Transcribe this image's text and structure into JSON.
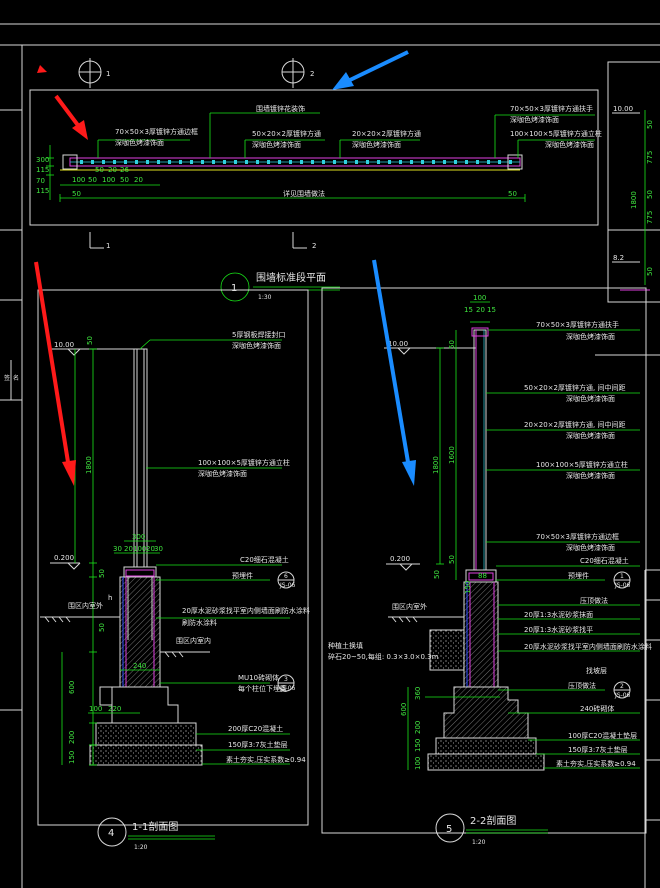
{
  "plan": {
    "title_num": "1",
    "title": "围墙标准段平面",
    "scale": "1:30",
    "section_marks": [
      "1",
      "2"
    ],
    "callouts": [
      "70×50×3厚镀锌方通边框",
      "深咖色烤漆饰面",
      "50×20×2厚镀锌方通",
      "深咖色烤漆饰面",
      "20×20×2厚镀锌方通",
      "深咖色烤漆饰面",
      "70×50×3厚镀锌方通扶手",
      "深咖色烤漆饰面",
      "100×100×5厚镀锌方通立柱",
      "深咖色烤漆饰面",
      "围墙镀锌花装饰",
      "详见围墙做法"
    ],
    "dims": [
      "300",
      "115",
      "70",
      "115",
      "100",
      "50",
      "100",
      "50",
      "20",
      "50",
      "20",
      "26",
      "20",
      "300"
    ]
  },
  "section1": {
    "title_num": "4",
    "title": "1-1剖面图",
    "scale": "1:20",
    "levels": [
      "10.00",
      "0.200"
    ],
    "dims": [
      "1800",
      "50",
      "50",
      "600",
      "200",
      "150",
      "100",
      "300",
      "30",
      "20",
      "100",
      "20",
      "30",
      "240",
      "100",
      "220"
    ],
    "callouts": [
      "5厚钢板焊接封口",
      "深咖色烤漆饰面",
      "100×100×5厚镀锌方通立柱",
      "深咖色烤漆饰面",
      "C20细石混凝土",
      "预埋件",
      "20厚水泥砂浆找平室内侧墙面刷防水涂料",
      "刷防水涂料",
      "MU10砖砌体",
      "每个柱位下埋置",
      "200厚C20混凝土",
      "150厚3:7灰土垫层",
      "素土夯实,压实系数≥0.94"
    ],
    "labels": [
      "围区内室外",
      "围区内室内",
      "h"
    ],
    "ref_circles": [
      "6",
      "3"
    ],
    "ref_sub": [
      "JS-06",
      "JS-06"
    ]
  },
  "section2": {
    "title_num": "5",
    "title": "2-2剖面图",
    "scale": "1:20",
    "levels": [
      "10.00",
      "0.200"
    ],
    "dims": [
      "1800",
      "50",
      "50",
      "1600",
      "50",
      "600",
      "360",
      "200",
      "150",
      "100",
      "15",
      "20",
      "15",
      "150",
      "88"
    ],
    "callouts": [
      "70×50×3厚镀锌方通扶手",
      "深咖色烤漆饰面",
      "50×20×2厚镀锌方通, 间中间距",
      "深咖色烤漆饰面",
      "20×20×2厚镀锌方通, 间中间距",
      "深咖色烤漆饰面",
      "100×100×5厚镀锌方通立柱",
      "深咖色烤漆饰面",
      "70×50×3厚镀锌方通边框",
      "深咖色烤漆饰面",
      "C20细石混凝土",
      "预埋件",
      "压顶做法",
      "20厚1:3水泥砂浆抹面",
      "20厚1:3水泥砂浆找平",
      "20厚水泥砂浆找平室内侧墙面刷防水涂料",
      "找坡层",
      "压顶做法",
      "240砖砌体",
      "100厚C20混凝土垫层",
      "150厚3:7灰土垫层",
      "素土夯实,压实系数≥0.94"
    ],
    "labels": [
      "围区内室外",
      "种植土换填",
      "碎石20~50,每组: 0.3×3.0×0.3m"
    ],
    "ref_circles": [
      "1",
      "2"
    ],
    "ref_sub": [
      "JS-06",
      "JS-06"
    ]
  },
  "side_panel": {
    "levels": [
      "10.00",
      "8.2"
    ],
    "dims": [
      "50",
      "775",
      "50",
      "50",
      "1800",
      "50",
      "775"
    ]
  },
  "colors": {
    "background": "#000000",
    "white_line": "#d8d8d8",
    "green_dim": "#19e619",
    "magenta": "#e040e0",
    "blue": "#3050ff",
    "cyan": "#30d0e0",
    "red_arrow": "#ff1a1a",
    "blue_arrow": "#1a8cff"
  }
}
